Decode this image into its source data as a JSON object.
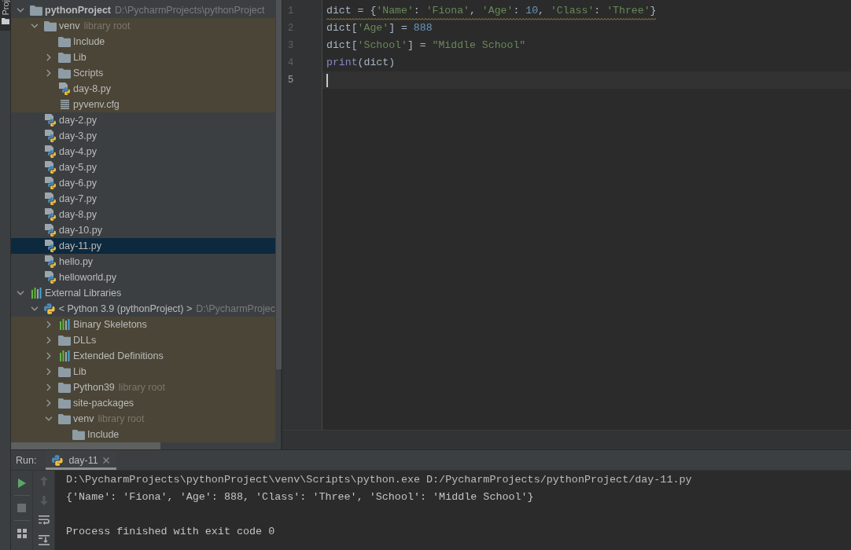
{
  "tool_strip": {
    "buttons": [
      {
        "label": "Proj",
        "selected": true
      }
    ]
  },
  "project_tree": {
    "items": [
      {
        "kind": "project",
        "name": "pythonProject",
        "hint": "D:\\PycharmProjects\\pythonProject",
        "expanded": true,
        "selected": false,
        "highlighted": false,
        "children": [
          {
            "kind": "folder",
            "name": "venv",
            "hint": "library root",
            "expanded": true,
            "selected": false,
            "highlighted": true,
            "children": [
              {
                "kind": "folder",
                "name": "Include",
                "selected": false,
                "highlighted": true
              },
              {
                "kind": "folder",
                "name": "Lib",
                "expanded": false,
                "selected": false,
                "highlighted": true
              },
              {
                "kind": "folder",
                "name": "Scripts",
                "expanded": false,
                "selected": false,
                "highlighted": true
              },
              {
                "kind": "python_file",
                "name": "day-8.py",
                "selected": false,
                "highlighted": true
              },
              {
                "kind": "config_file",
                "name": "pyvenv.cfg",
                "selected": false,
                "highlighted": true
              }
            ]
          },
          {
            "kind": "python_file",
            "name": "day-2.py",
            "selected": false,
            "highlighted": false
          },
          {
            "kind": "python_file",
            "name": "day-3.py",
            "selected": false,
            "highlighted": false
          },
          {
            "kind": "python_file",
            "name": "day-4.py",
            "selected": false,
            "highlighted": false
          },
          {
            "kind": "python_file",
            "name": "day-5.py",
            "selected": false,
            "highlighted": false
          },
          {
            "kind": "python_file",
            "name": "day-6.py",
            "selected": false,
            "highlighted": false
          },
          {
            "kind": "python_file",
            "name": "day-7.py",
            "selected": false,
            "highlighted": false
          },
          {
            "kind": "python_file",
            "name": "day-8.py",
            "selected": false,
            "highlighted": false
          },
          {
            "kind": "python_file",
            "name": "day-10.py",
            "selected": false,
            "highlighted": false
          },
          {
            "kind": "python_file",
            "name": "day-11.py",
            "selected": true,
            "highlighted": false
          },
          {
            "kind": "python_file",
            "name": "hello.py",
            "selected": false,
            "highlighted": false
          },
          {
            "kind": "python_file",
            "name": "helloworld.py",
            "selected": false,
            "highlighted": false
          }
        ]
      },
      {
        "kind": "libraries",
        "name": "External Libraries",
        "expanded": true,
        "selected": false,
        "highlighted": false,
        "children": [
          {
            "kind": "python_sdk",
            "name": "< Python 3.9 (pythonProject) >",
            "hint": "D:\\PycharmProjec",
            "expanded": true,
            "selected": false,
            "highlighted": false,
            "children": [
              {
                "kind": "library",
                "name": "Binary Skeletons",
                "expanded": false,
                "selected": false,
                "highlighted": true
              },
              {
                "kind": "folder",
                "name": "DLLs",
                "expanded": false,
                "selected": false,
                "highlighted": true
              },
              {
                "kind": "library",
                "name": "Extended Definitions",
                "expanded": false,
                "selected": false,
                "highlighted": true
              },
              {
                "kind": "folder",
                "name": "Lib",
                "expanded": false,
                "selected": false,
                "highlighted": true
              },
              {
                "kind": "folder",
                "name": "Python39",
                "hint": "library root",
                "expanded": false,
                "selected": false,
                "highlighted": true
              },
              {
                "kind": "folder",
                "name": "site-packages",
                "expanded": false,
                "selected": false,
                "highlighted": true
              },
              {
                "kind": "folder",
                "name": "venv",
                "hint": "library root",
                "expanded": true,
                "selected": false,
                "highlighted": true,
                "children": [
                  {
                    "kind": "folder",
                    "name": "Include",
                    "selected": false,
                    "highlighted": true
                  }
                ]
              }
            ]
          }
        ]
      }
    ]
  },
  "editor": {
    "lines": [
      {
        "number": "1",
        "current": false,
        "warning": true,
        "tokens": [
          {
            "kind": "plain",
            "text": "dict = {"
          },
          {
            "kind": "string",
            "text": "'Name'"
          },
          {
            "kind": "plain",
            "text": ": "
          },
          {
            "kind": "string",
            "text": "'Fiona'"
          },
          {
            "kind": "plain",
            "text": ", "
          },
          {
            "kind": "string",
            "text": "'Age'"
          },
          {
            "kind": "plain",
            "text": ": "
          },
          {
            "kind": "number",
            "text": "10"
          },
          {
            "kind": "plain",
            "text": ", "
          },
          {
            "kind": "string",
            "text": "'Class'"
          },
          {
            "kind": "plain",
            "text": ": "
          },
          {
            "kind": "string",
            "text": "'Three'"
          },
          {
            "kind": "plain",
            "text": "}"
          }
        ]
      },
      {
        "number": "2",
        "current": false,
        "warning": false,
        "tokens": [
          {
            "kind": "plain",
            "text": "dict["
          },
          {
            "kind": "string",
            "text": "'Age'"
          },
          {
            "kind": "plain",
            "text": "] = "
          },
          {
            "kind": "number",
            "text": "888"
          }
        ]
      },
      {
        "number": "3",
        "current": false,
        "warning": false,
        "tokens": [
          {
            "kind": "plain",
            "text": "dict["
          },
          {
            "kind": "string",
            "text": "'School'"
          },
          {
            "kind": "plain",
            "text": "] = "
          },
          {
            "kind": "string",
            "text": "\"Middle School\""
          }
        ]
      },
      {
        "number": "4",
        "current": false,
        "warning": false,
        "tokens": [
          {
            "kind": "builtin",
            "text": "print"
          },
          {
            "kind": "plain",
            "text": "(dict)"
          }
        ]
      },
      {
        "number": "5",
        "current": true,
        "warning": false
      }
    ]
  },
  "run_panel": {
    "label": "Run:",
    "tabs": [
      {
        "label": "day-11",
        "selected": true
      }
    ],
    "toolbars": [
      {
        "buttons": [
          {
            "kind": "run",
            "disabled": false
          },
          {
            "kind": "stop",
            "disabled": true
          },
          {
            "kind": "layout",
            "disabled": false
          }
        ]
      },
      {
        "buttons": [
          {
            "kind": "up",
            "disabled": true
          },
          {
            "kind": "down",
            "disabled": true
          },
          {
            "kind": "soft_wrap",
            "disabled": false
          },
          {
            "kind": "scroll_to_end",
            "disabled": false
          }
        ]
      }
    ],
    "output": [
      {
        "kind": "command",
        "text": "D:\\PycharmProjects\\pythonProject\\venv\\Scripts\\python.exe D:/PycharmProjects/pythonProject/day-11.py"
      },
      {
        "kind": "stdout",
        "text": "{'Name': 'Fiona', 'Age': 888, 'Class': 'Three', 'School': 'Middle School'}"
      },
      {
        "kind": "exit",
        "text": "Process finished with exit code 0"
      }
    ]
  }
}
